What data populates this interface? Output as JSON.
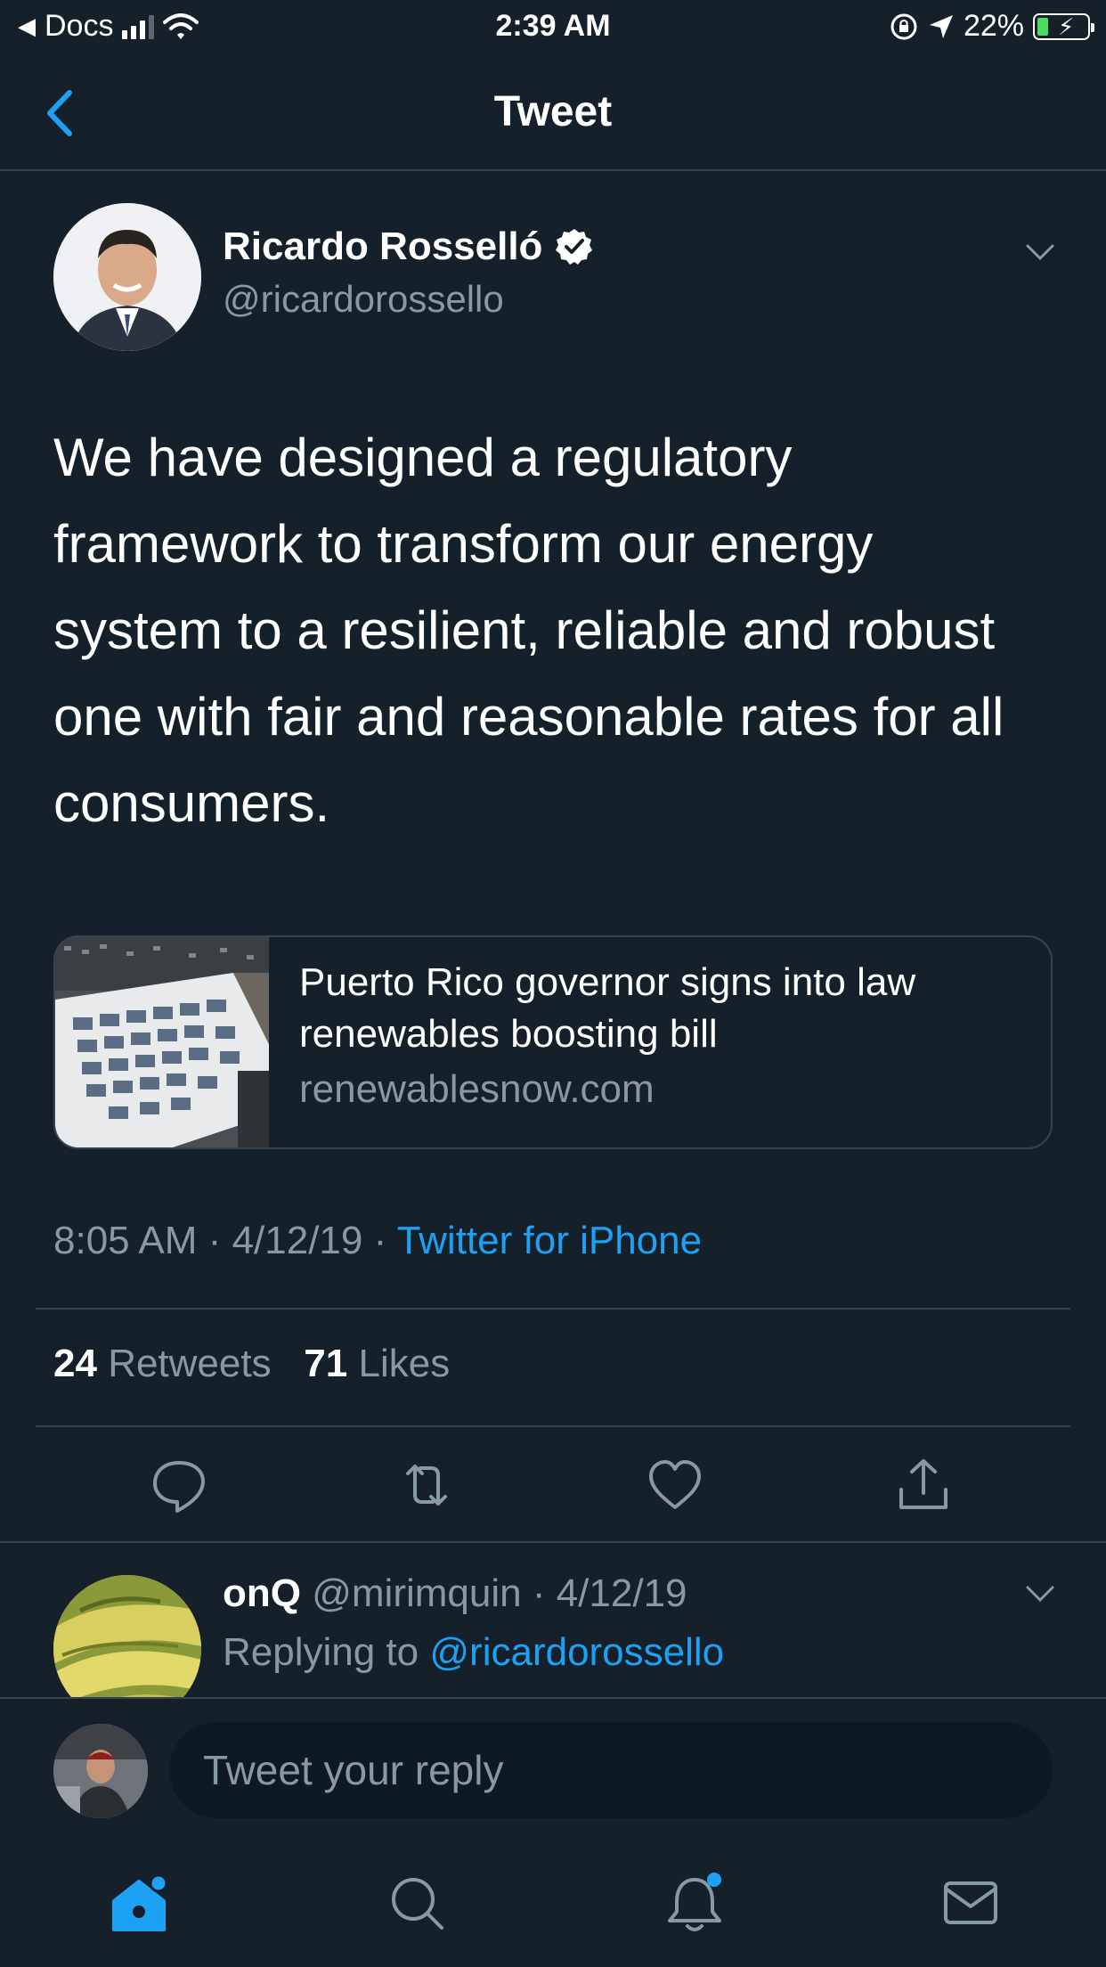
{
  "status_bar": {
    "back_app": "Docs",
    "time": "2:39 AM",
    "battery": "22%"
  },
  "nav": {
    "title": "Tweet"
  },
  "tweet": {
    "author_name": "Ricardo Rosselló",
    "author_handle": "@ricardorossello",
    "text": "We have designed a regulatory framework to transform our energy system to a resilient, reliable and robust one with fair and reasonable rates for all consumers.",
    "card": {
      "title": "Puerto Rico governor signs into law renewables boosting bill",
      "domain": "renewablesnow.com"
    },
    "time": "8:05 AM",
    "date": "4/12/19",
    "source": "Twitter for iPhone",
    "retweets_count": "24",
    "retweets_label": "Retweets",
    "likes_count": "71",
    "likes_label": "Likes"
  },
  "reply_preview": {
    "name": "onQ",
    "handle": "@mirimquin",
    "date": "4/12/19",
    "replying_label": "Replying to",
    "replying_to": "@ricardorossello"
  },
  "composer": {
    "placeholder": "Tweet your reply"
  },
  "colors": {
    "background": "#15202b",
    "accent": "#1da1f2",
    "muted": "#8899a6",
    "divider": "#38444d"
  },
  "icons": {
    "actions": [
      "reply-icon",
      "retweet-icon",
      "like-icon",
      "share-icon"
    ],
    "tabbar": [
      "home-icon",
      "search-icon",
      "notifications-icon",
      "messages-icon"
    ]
  }
}
